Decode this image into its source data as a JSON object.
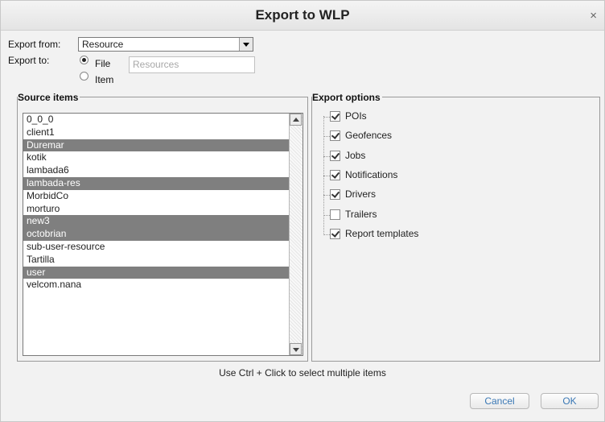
{
  "dialog": {
    "title": "Export to WLP",
    "close_glyph": "×"
  },
  "export_from": {
    "label": "Export from:",
    "selected": "Resource"
  },
  "export_to": {
    "label": "Export to:",
    "options": [
      {
        "label": "File",
        "checked": true
      },
      {
        "label": "Item",
        "checked": false
      }
    ],
    "file_name_placeholder": "Resources"
  },
  "source_items": {
    "legend": "Source items",
    "items": [
      {
        "label": "0_0_0",
        "selected": false
      },
      {
        "label": "client1",
        "selected": false
      },
      {
        "label": "Duremar",
        "selected": true
      },
      {
        "label": "kotik",
        "selected": false
      },
      {
        "label": "lambada6",
        "selected": false
      },
      {
        "label": "lambada-res",
        "selected": true
      },
      {
        "label": "MorbidCo",
        "selected": false
      },
      {
        "label": "morturo",
        "selected": false
      },
      {
        "label": "new3",
        "selected": true
      },
      {
        "label": "octobrian",
        "selected": true
      },
      {
        "label": "sub-user-resource",
        "selected": false
      },
      {
        "label": "Tartilla",
        "selected": false
      },
      {
        "label": "user",
        "selected": true
      },
      {
        "label": "velcom.nana",
        "selected": false
      }
    ]
  },
  "export_options": {
    "legend": "Export options",
    "items": [
      {
        "label": "POIs",
        "checked": true
      },
      {
        "label": "Geofences",
        "checked": true
      },
      {
        "label": "Jobs",
        "checked": true
      },
      {
        "label": "Notifications",
        "checked": true
      },
      {
        "label": "Drivers",
        "checked": true
      },
      {
        "label": "Trailers",
        "checked": false
      },
      {
        "label": "Report templates",
        "checked": true
      }
    ]
  },
  "hint": "Use Ctrl + Click to select multiple items",
  "buttons": {
    "cancel": "Cancel",
    "ok": "OK"
  },
  "colors": {
    "selection": "#7f7f7f",
    "button_text": "#3a78b5"
  }
}
